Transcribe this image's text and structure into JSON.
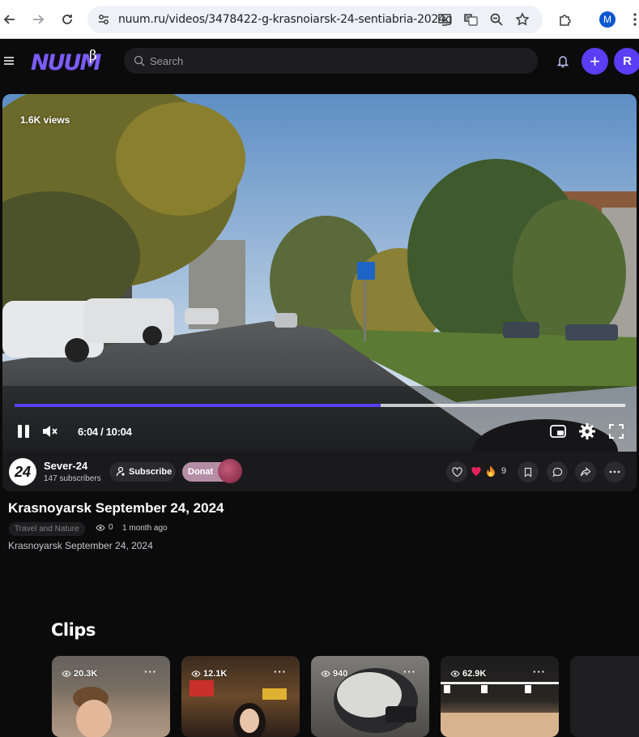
{
  "browser": {
    "url": "nuum.ru/videos/3478422-g-krasnoiarsk-24-sentiabria-2024g",
    "profile_initial": "M"
  },
  "header": {
    "logo_text": "NUUM",
    "logo_beta": "β",
    "search_placeholder": "Search",
    "plus_label": "+",
    "avatar_initial": "R",
    "accent_color": "#5b3df5"
  },
  "player": {
    "views": "1.6K views",
    "time": "6:04 / 10:04",
    "progress": 0.6
  },
  "channel": {
    "avatar_text": "24",
    "name": "Sever-24",
    "subscribers": "147 subscribers",
    "subscribe_label": "Subscribe",
    "donate_label": "Donat",
    "reaction_count": "9"
  },
  "video": {
    "title": "Krasnoyarsk September 24, 2024",
    "category": "Travel and Nature",
    "view_count": "0",
    "age": "1 month ago",
    "description": "Krasnoyarsk September 24, 2024"
  },
  "clips": {
    "title": "Clips",
    "items": [
      {
        "views": "20.3K",
        "more": "···"
      },
      {
        "views": "12.1K",
        "more": "···"
      },
      {
        "views": "940",
        "more": "···"
      },
      {
        "views": "62.9K",
        "more": "···"
      }
    ]
  }
}
